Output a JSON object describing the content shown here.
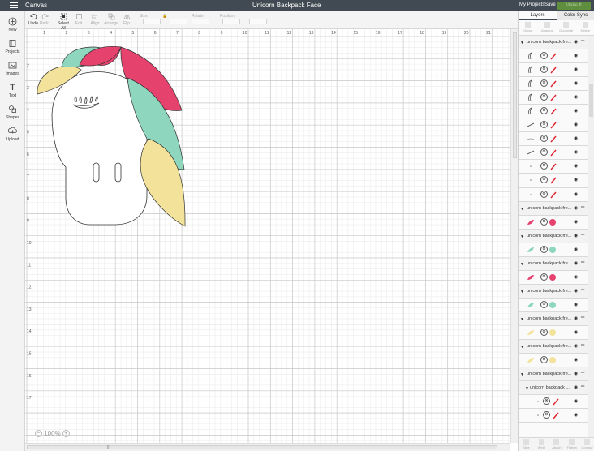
{
  "header": {
    "app_title": "Canvas",
    "project_name": "Unicorn Backpack Face",
    "my_projects": "My Projects",
    "save": "Save",
    "make_it": "Make It"
  },
  "rail": [
    {
      "label": "New",
      "icon": "plus-circle-icon"
    },
    {
      "label": "Projects",
      "icon": "book-icon"
    },
    {
      "label": "Images",
      "icon": "image-icon"
    },
    {
      "label": "Text",
      "icon": "text-icon"
    },
    {
      "label": "Shapes",
      "icon": "shapes-icon"
    },
    {
      "label": "Upload",
      "icon": "upload-icon"
    }
  ],
  "toolbar": {
    "undo": "Undo",
    "redo": "Redo",
    "select_all": "Select All",
    "edit": "Edit",
    "align": "Align",
    "arrange": "Arrange",
    "flip": "Flip",
    "size": "Size",
    "rotate": "Rotate",
    "position": "Position"
  },
  "canvas": {
    "zoom": "100%",
    "ruler_top": [
      "1",
      "2",
      "3",
      "4",
      "5",
      "6",
      "7",
      "8",
      "9",
      "10",
      "11",
      "12",
      "13",
      "14",
      "15",
      "16",
      "17",
      "18",
      "19",
      "20",
      "21"
    ],
    "ruler_left": [
      "1",
      "2",
      "3",
      "4",
      "5",
      "6",
      "7",
      "8",
      "9",
      "10",
      "11",
      "12",
      "13",
      "14",
      "15",
      "16",
      "17"
    ],
    "colors": {
      "pink": "#e5426e",
      "mint": "#8fd6bf",
      "yellow": "#f2e29a"
    }
  },
  "panel": {
    "tabs": [
      "Layers",
      "Color Sync"
    ],
    "tools": [
      "Group",
      "Ungroup",
      "Duplicate",
      "Delete"
    ],
    "bottom_tools": [
      "Slice",
      "Weld",
      "Attach",
      "Flatten",
      "Contour"
    ],
    "layers": [
      {
        "type": "group",
        "name": "unicorn backpack fre..."
      },
      {
        "type": "item",
        "thumb": "lash",
        "action": "pen"
      },
      {
        "type": "item",
        "thumb": "lash",
        "action": "pen"
      },
      {
        "type": "item",
        "thumb": "lash",
        "action": "pen"
      },
      {
        "type": "item",
        "thumb": "lash",
        "action": "pen"
      },
      {
        "type": "item",
        "thumb": "lash",
        "action": "pen"
      },
      {
        "type": "item",
        "thumb": "line",
        "action": "pen"
      },
      {
        "type": "item",
        "thumb": "curve",
        "action": "pen"
      },
      {
        "type": "item",
        "thumb": "line",
        "action": "pen"
      },
      {
        "type": "item",
        "thumb": "dot",
        "action": "pen"
      },
      {
        "type": "item",
        "thumb": "dot",
        "action": "pen"
      },
      {
        "type": "item",
        "thumb": "dot",
        "action": "pen"
      },
      {
        "type": "group",
        "name": "unicorn backpack fre..."
      },
      {
        "type": "item",
        "thumb": "pink",
        "action": "swatch",
        "color": "#e5426e"
      },
      {
        "type": "group",
        "name": "unicorn backpack fre..."
      },
      {
        "type": "item",
        "thumb": "mint",
        "action": "swatch",
        "color": "#8fd6bf"
      },
      {
        "type": "group",
        "name": "unicorn backpack fre..."
      },
      {
        "type": "item",
        "thumb": "pink",
        "action": "swatch",
        "color": "#e5426e"
      },
      {
        "type": "group",
        "name": "unicorn backpack fre..."
      },
      {
        "type": "item",
        "thumb": "mint",
        "action": "swatch",
        "color": "#8fd6bf"
      },
      {
        "type": "group",
        "name": "unicorn backpack fre..."
      },
      {
        "type": "item",
        "thumb": "yellow",
        "action": "swatch",
        "color": "#f2e29a"
      },
      {
        "type": "group",
        "name": "unicorn backpack fre..."
      },
      {
        "type": "item",
        "thumb": "yellow",
        "action": "swatch",
        "color": "#f2e29a"
      },
      {
        "type": "group",
        "name": "unicorn backpack fre..."
      },
      {
        "type": "subgroup",
        "name": "unicorn backpack ..."
      },
      {
        "type": "subitem",
        "thumb": "dot",
        "action": "pen"
      },
      {
        "type": "subitem",
        "thumb": "dot",
        "action": "pen"
      }
    ]
  }
}
